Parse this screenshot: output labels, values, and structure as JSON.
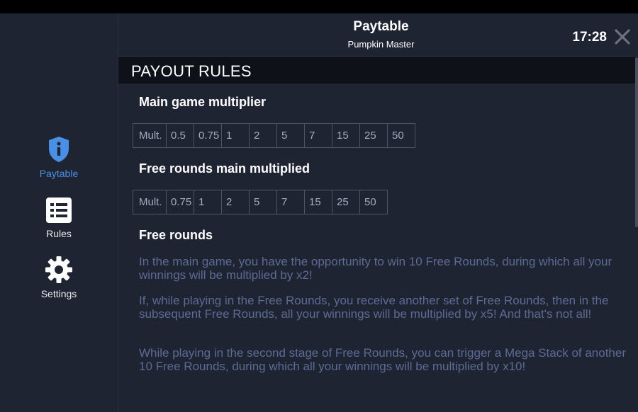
{
  "sidebar": {
    "items": [
      {
        "label": "Paytable",
        "icon": "info-shield-icon",
        "active": true
      },
      {
        "label": "Rules",
        "icon": "list-icon",
        "active": false
      },
      {
        "label": "Settings",
        "icon": "gear-icon",
        "active": false
      }
    ]
  },
  "header": {
    "title": "Paytable",
    "subtitle": "Pumpkin Master",
    "time": "17:28"
  },
  "section": {
    "title": "PAYOUT RULES"
  },
  "main_multiplier": {
    "heading": "Main game multiplier",
    "cells": [
      "Mult.",
      "0.5",
      "0.75",
      "1",
      "2",
      "5",
      "7",
      "15",
      "25",
      "50"
    ]
  },
  "free_multiplier": {
    "heading": "Free rounds main multiplied",
    "cells": [
      "Mult.",
      "0.75",
      "1",
      "2",
      "5",
      "7",
      "15",
      "25",
      "50"
    ]
  },
  "free_rounds": {
    "heading": "Free rounds",
    "p1": "In the main game, you have the opportunity to win 10 Free Rounds, during which all your winnings will be multiplied by x2!",
    "p2": "If, while playing in the Free Rounds, you receive another set of Free Rounds, then in the subsequent Free Rounds, all your winnings will be multiplied by x5! And that's not all!",
    "p3": "While playing in the second stage of Free Rounds, you can trigger a Mega Stack of another 10 Free Rounds, during which all your winnings will be multiplied by x10!"
  },
  "colors": {
    "accent": "#4a8fe6",
    "background": "#1e2432",
    "section_bar": "#0e1118",
    "paragraph": "#5d6b94"
  }
}
